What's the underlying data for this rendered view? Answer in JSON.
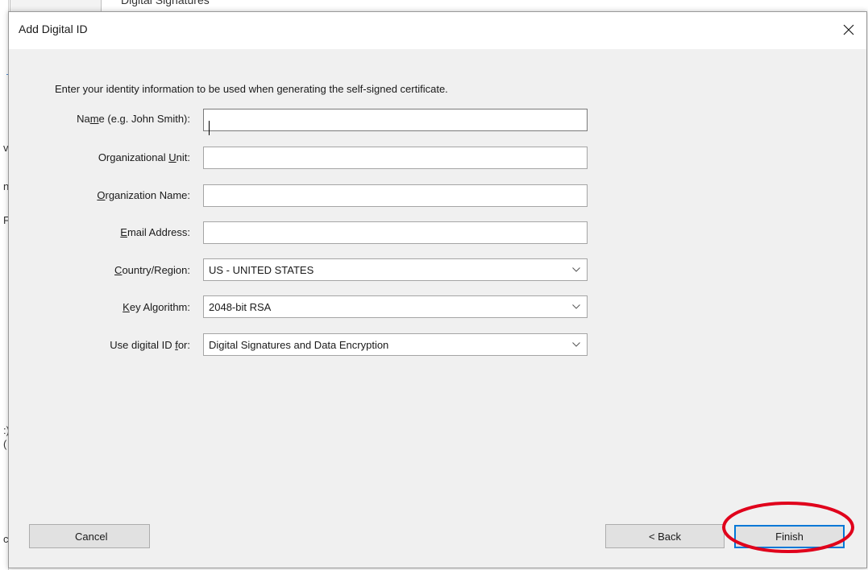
{
  "background_window": {
    "title_fragment": "Digital Signatures",
    "edge_glyphs": [
      "v",
      "n",
      "F",
      ":)",
      "(",
      "c"
    ]
  },
  "dialog": {
    "title": "Add Digital ID",
    "close_icon": "close-icon",
    "intro": "Enter your identity information to be used when generating the self-signed certificate.",
    "fields": {
      "name": {
        "label_pre": "Na",
        "label_u": "m",
        "label_post": "e (e.g. John Smith):",
        "value": ""
      },
      "org_unit": {
        "label_pre": "Organizational ",
        "label_u": "U",
        "label_post": "nit:",
        "value": ""
      },
      "org_name": {
        "label_pre": "",
        "label_u": "O",
        "label_post": "rganization Name:",
        "value": ""
      },
      "email": {
        "label_pre": "",
        "label_u": "E",
        "label_post": "mail Address:",
        "value": ""
      },
      "country": {
        "label_pre": "",
        "label_u": "C",
        "label_post": "ountry/Region:",
        "value": "US - UNITED STATES"
      },
      "key_algorithm": {
        "label_pre": "",
        "label_u": "K",
        "label_post": "ey Algorithm:",
        "value": "2048-bit RSA"
      },
      "use_for": {
        "label_pre": "Use digital ID ",
        "label_u": "f",
        "label_post": "or:",
        "value": "Digital Signatures and Data Encryption"
      }
    },
    "buttons": {
      "cancel": "Cancel",
      "back": "< Back",
      "finish": "Finish"
    }
  },
  "colors": {
    "dialog_bg": "#f0f0f0",
    "focus_blue": "#0078d7",
    "annotation_red": "#e0001b"
  }
}
